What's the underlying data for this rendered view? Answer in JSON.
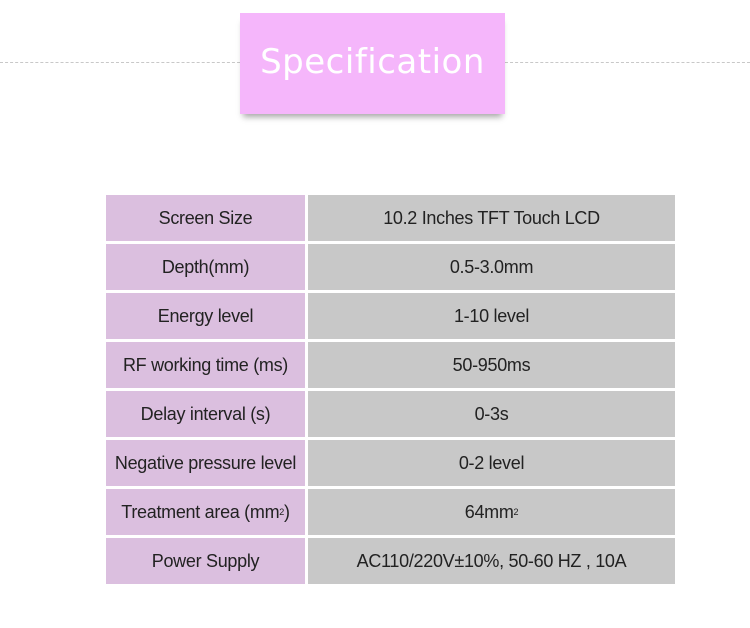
{
  "header": {
    "title": "Specification",
    "accent_color": "#f5b6fb"
  },
  "table": {
    "label_bg": "#dbbfdf",
    "value_bg": "#c8c8c8",
    "rows": [
      {
        "label": "Screen Size",
        "value": "10.2 Inches TFT Touch LCD"
      },
      {
        "label": "Depth(mm)",
        "value": "0.5-3.0mm"
      },
      {
        "label": "Energy level",
        "value": "1-10 level"
      },
      {
        "label": "RF working time (ms)",
        "value": "50-950ms"
      },
      {
        "label": "Delay interval (s)",
        "value": "0-3s"
      },
      {
        "label": "Negative pressure level",
        "value": "0-2 level"
      },
      {
        "label": "Treatment area (mm",
        "label_sup": "2",
        "label_suffix": ")",
        "value": "64mm",
        "value_sup": "2"
      },
      {
        "label": "Power Supply",
        "value": "AC110/220V±10%, 50-60 HZ , 10A"
      }
    ]
  }
}
